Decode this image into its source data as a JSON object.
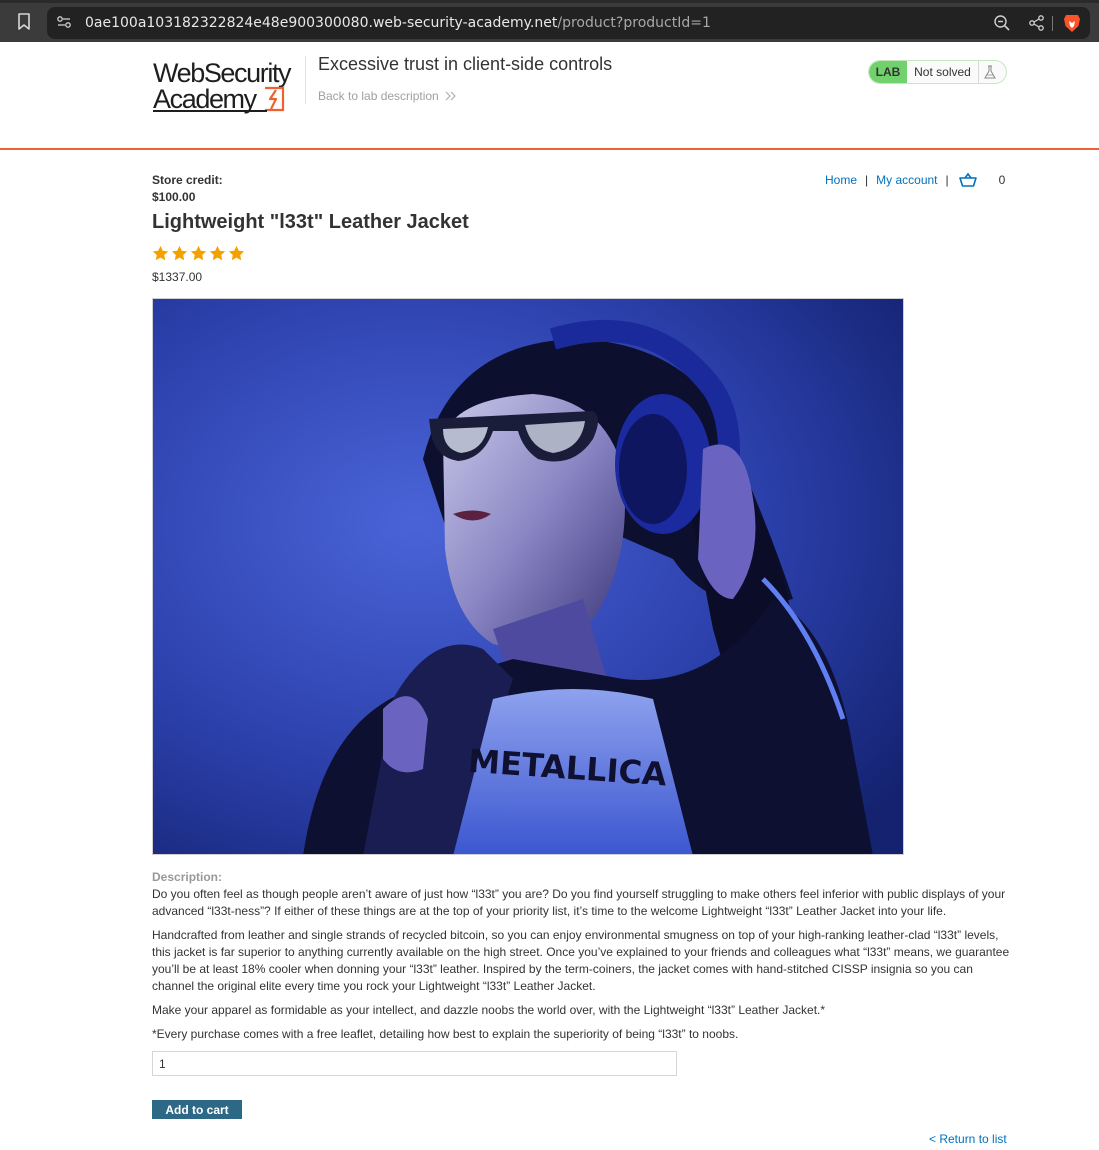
{
  "browser": {
    "url_host": "0ae100a103182322824e48e900300080.web-security-academy.net",
    "url_path": "/product?productId=1"
  },
  "academy": {
    "logo_line1": "WebSecurity",
    "logo_line2": "Academy",
    "lab_title": "Excessive trust in client-side controls",
    "back_link": "Back to lab description",
    "status_tag": "LAB",
    "status_text": "Not solved"
  },
  "store": {
    "credit_label": "Store credit:",
    "credit_value": "$100.00",
    "nav": {
      "home": "Home",
      "separator": "|",
      "my_account": "My account",
      "cart_count": "0"
    }
  },
  "product": {
    "title": "Lightweight \"l33t\" Leather Jacket",
    "rating": 5,
    "rating_max": 5,
    "price": "$1337.00",
    "image_print": "METALLICA",
    "description_label": "Description:",
    "description": [
      "Do you often feel as though people aren’t aware of just how “l33t” you are? Do you find yourself struggling to make others feel inferior with public displays of your advanced “l33t-ness”? If either of these things are at the top of your priority list, it’s time to the welcome Lightweight “l33t” Leather Jacket into your life.",
      "Handcrafted from leather and single strands of recycled bitcoin, so you can enjoy environmental smugness on top of your high-ranking leather-clad “l33t” levels, this jacket is far superior to anything currently available on the high street. Once you’ve explained to your friends and colleagues what “l33t” means, we guarantee you’ll be at least 18% cooler when donning your “l33t” leather. Inspired by the term-coiners, the jacket comes with hand-stitched CISSP insignia so you can channel the original elite every time you rock your Lightweight “l33t” Leather Jacket.",
      "Make your apparel as formidable as your intellect, and dazzle noobs the world over, with the Lightweight “l33t” Leather Jacket.*",
      "*Every purchase comes with a free leaflet, detailing how best to explain the superiority of being “l33t” to noobs."
    ],
    "quantity": "1",
    "add_to_cart": "Add to cart",
    "return_link": "< Return to list"
  },
  "colors": {
    "brand_orange": "#ec6233",
    "link_blue": "#0071bc",
    "button_blue": "#2d6987",
    "lab_green": "#70d16d",
    "star_orange": "#f4a100"
  },
  "icons": [
    "bookmark-icon",
    "site-settings-icon",
    "zoom-out-icon",
    "share-icon",
    "brave-lion-icon",
    "double-chevron-right-icon",
    "flask-icon",
    "shopping-cart-icon",
    "star-icon"
  ]
}
